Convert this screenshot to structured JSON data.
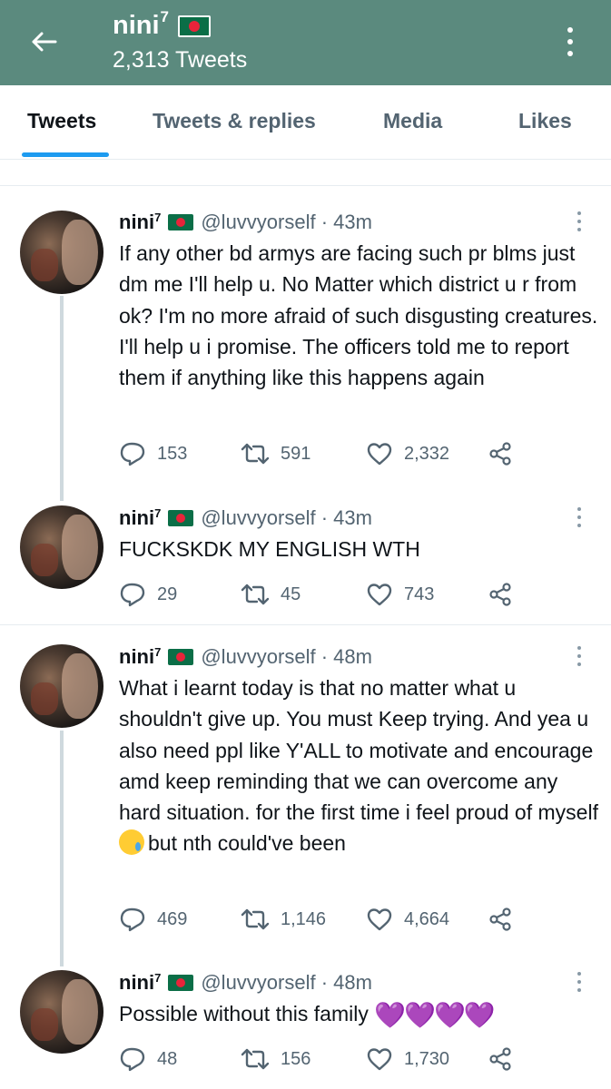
{
  "header": {
    "title": "nini",
    "title_sup": "7",
    "subtitle": "2,313 Tweets"
  },
  "tabs": [
    {
      "label": "Tweets",
      "active": true
    },
    {
      "label": "Tweets & replies",
      "active": false
    },
    {
      "label": "Media",
      "active": false
    },
    {
      "label": "Likes",
      "active": false
    }
  ],
  "tweets": [
    {
      "name": "nini",
      "name_sup": "7",
      "handle": "@luvvyorself · 43m",
      "text": "If any other bd armys are facing such pr blms just dm me I'll help u. No Matter which district u r from ok? I'm no more afraid of such disgusting creatures. I'll help u i promise. The officers told me to report them if anything like this happens again",
      "replies": "153",
      "retweets": "591",
      "likes": "2,332"
    },
    {
      "name": "nini",
      "name_sup": "7",
      "handle": "@luvvyorself · 43m",
      "text": "FUCKSKDK MY ENGLISH WTH",
      "replies": "29",
      "retweets": "45",
      "likes": "743"
    },
    {
      "name": "nini",
      "name_sup": "7",
      "handle": "@luvvyorself · 48m",
      "text_before_emoji": "What i learnt today is that no matter what u shouldn't give up. You must Keep trying. And yea u also need ppl like Y'ALL to motivate and encourage amd keep reminding that we can overcome any hard situation. for the first time i feel proud of myself",
      "text_after_emoji": "but nth could've been",
      "emoji": "crying-face-emoji",
      "replies": "469",
      "retweets": "1,146",
      "likes": "4,664"
    },
    {
      "name": "nini",
      "name_sup": "7",
      "handle": "@luvvyorself · 48m",
      "text": "Possible without this family",
      "hearts": "💜💜💜💜",
      "replies": "48",
      "retweets": "156",
      "likes": "1,730"
    }
  ],
  "colors": {
    "header_bg": "#5b8a7e",
    "tab_indicator": "#1d9bf0",
    "heart_purple": "#b79cdc",
    "flag_green": "#0b6e47",
    "flag_red": "#e8243a"
  },
  "icons": [
    "back-arrow-icon",
    "more-vertical-icon",
    "bangladesh-flag-icon",
    "reply-icon",
    "retweet-icon",
    "like-icon",
    "share-icon"
  ]
}
